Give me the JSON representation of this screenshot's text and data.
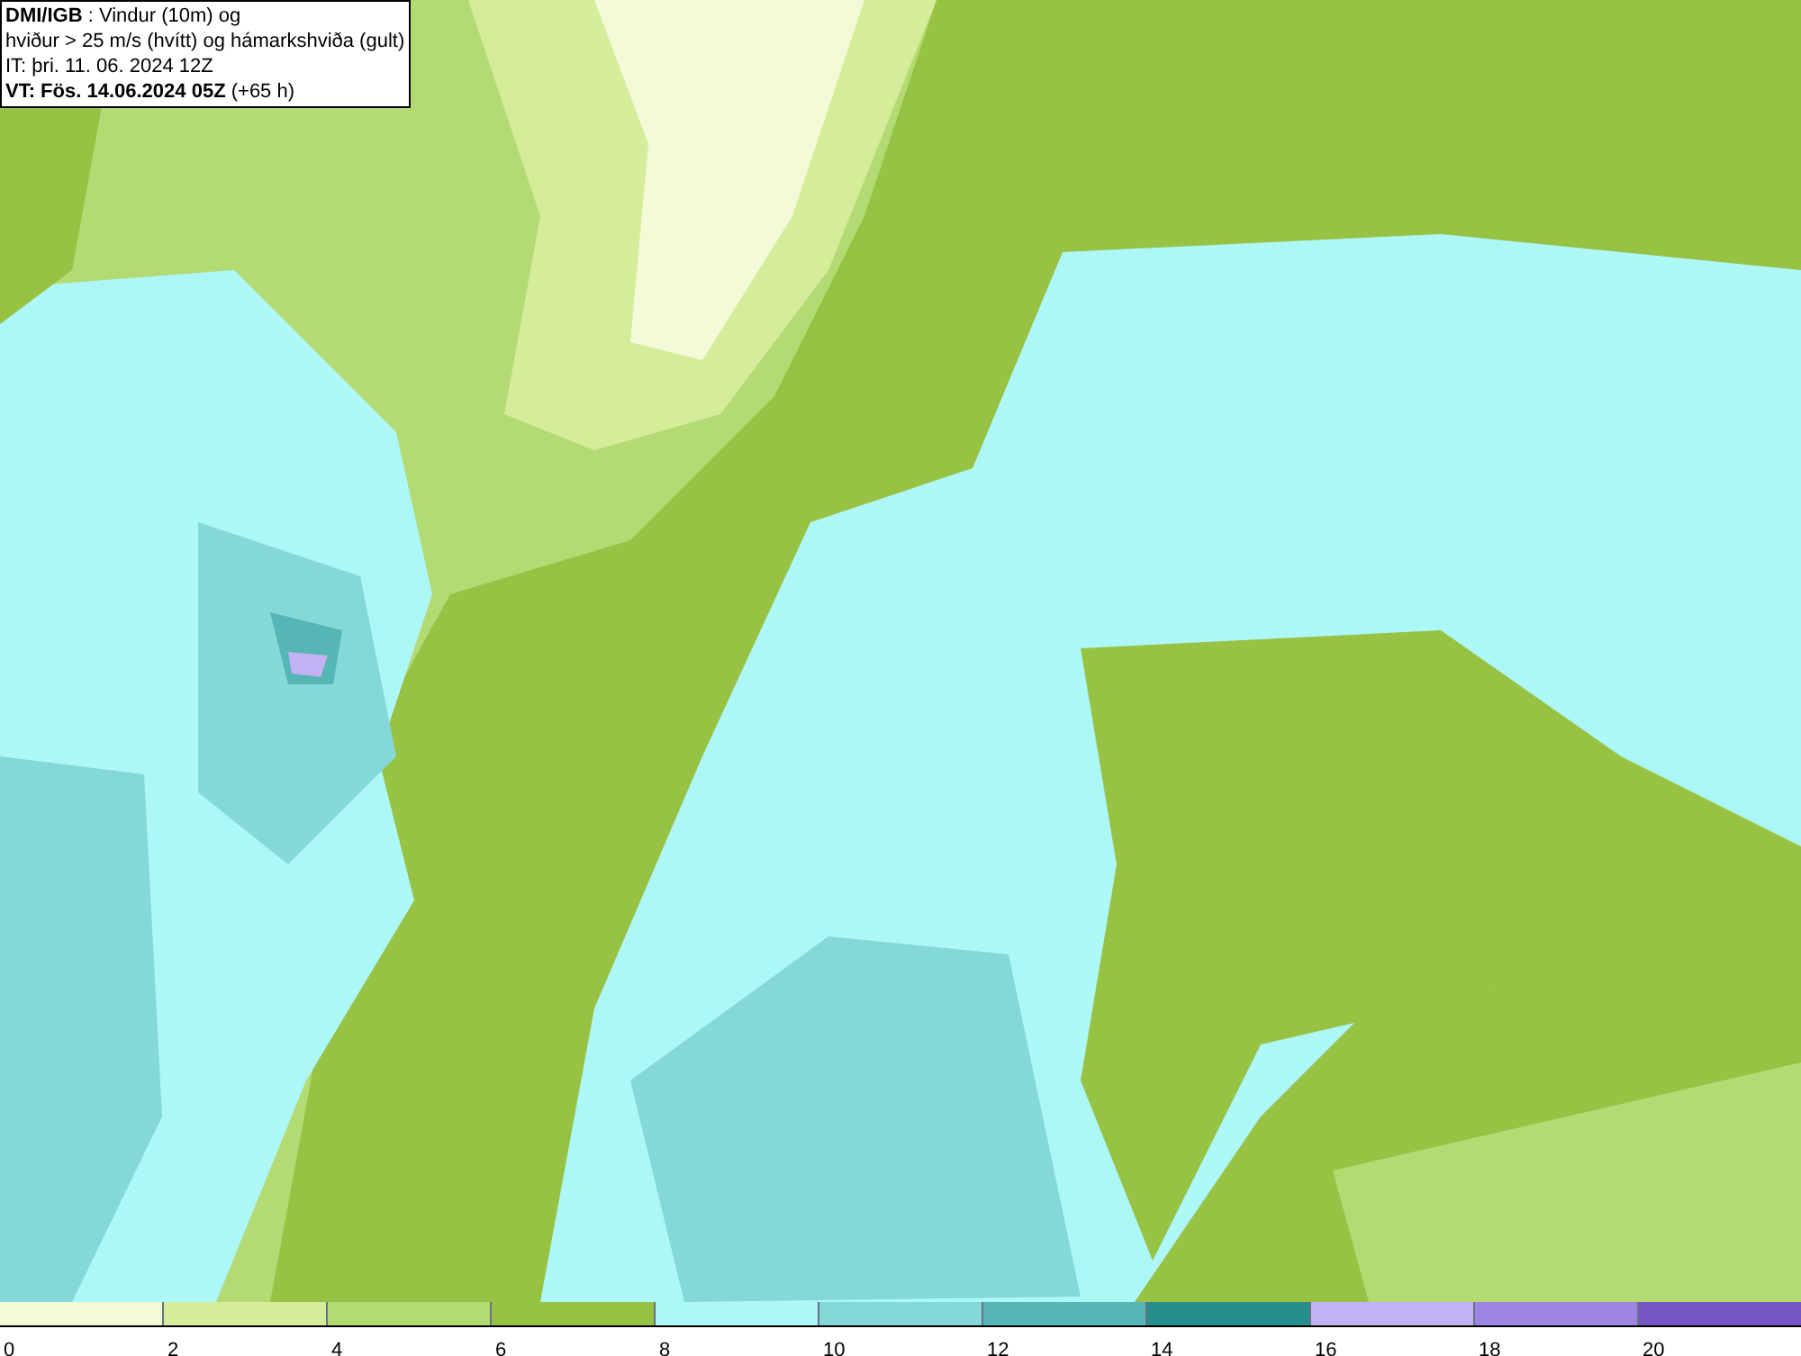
{
  "caption": {
    "lines": [
      "**DMI/IGB** : Vindur (10m) og",
      "hviður > 25 m/s (hvítt) og hámarkshviða (gult)",
      "IT: þri. 11. 06. 2024 12Z",
      "**VT: Fös. 14.06.2024 05Z** (+65 h)"
    ]
  },
  "colorbar": {
    "segments": [
      {
        "label": "0",
        "color": "#f4fad8"
      },
      {
        "label": "2",
        "color": "#d5ec9b"
      },
      {
        "label": "4",
        "color": "#b4da74"
      },
      {
        "label": "6",
        "color": "#98c244"
      },
      {
        "label": "8",
        "color": "#adf7f7"
      },
      {
        "label": "10",
        "color": "#84d8d8"
      },
      {
        "label": "12",
        "color": "#56b5b5"
      },
      {
        "label": "14",
        "color": "#278e8e"
      },
      {
        "label": "16",
        "color": "#c3b2f3"
      },
      {
        "label": "18",
        "color": "#9c86e1"
      },
      {
        "label": "20",
        "color": "#7356c3"
      }
    ]
  }
}
